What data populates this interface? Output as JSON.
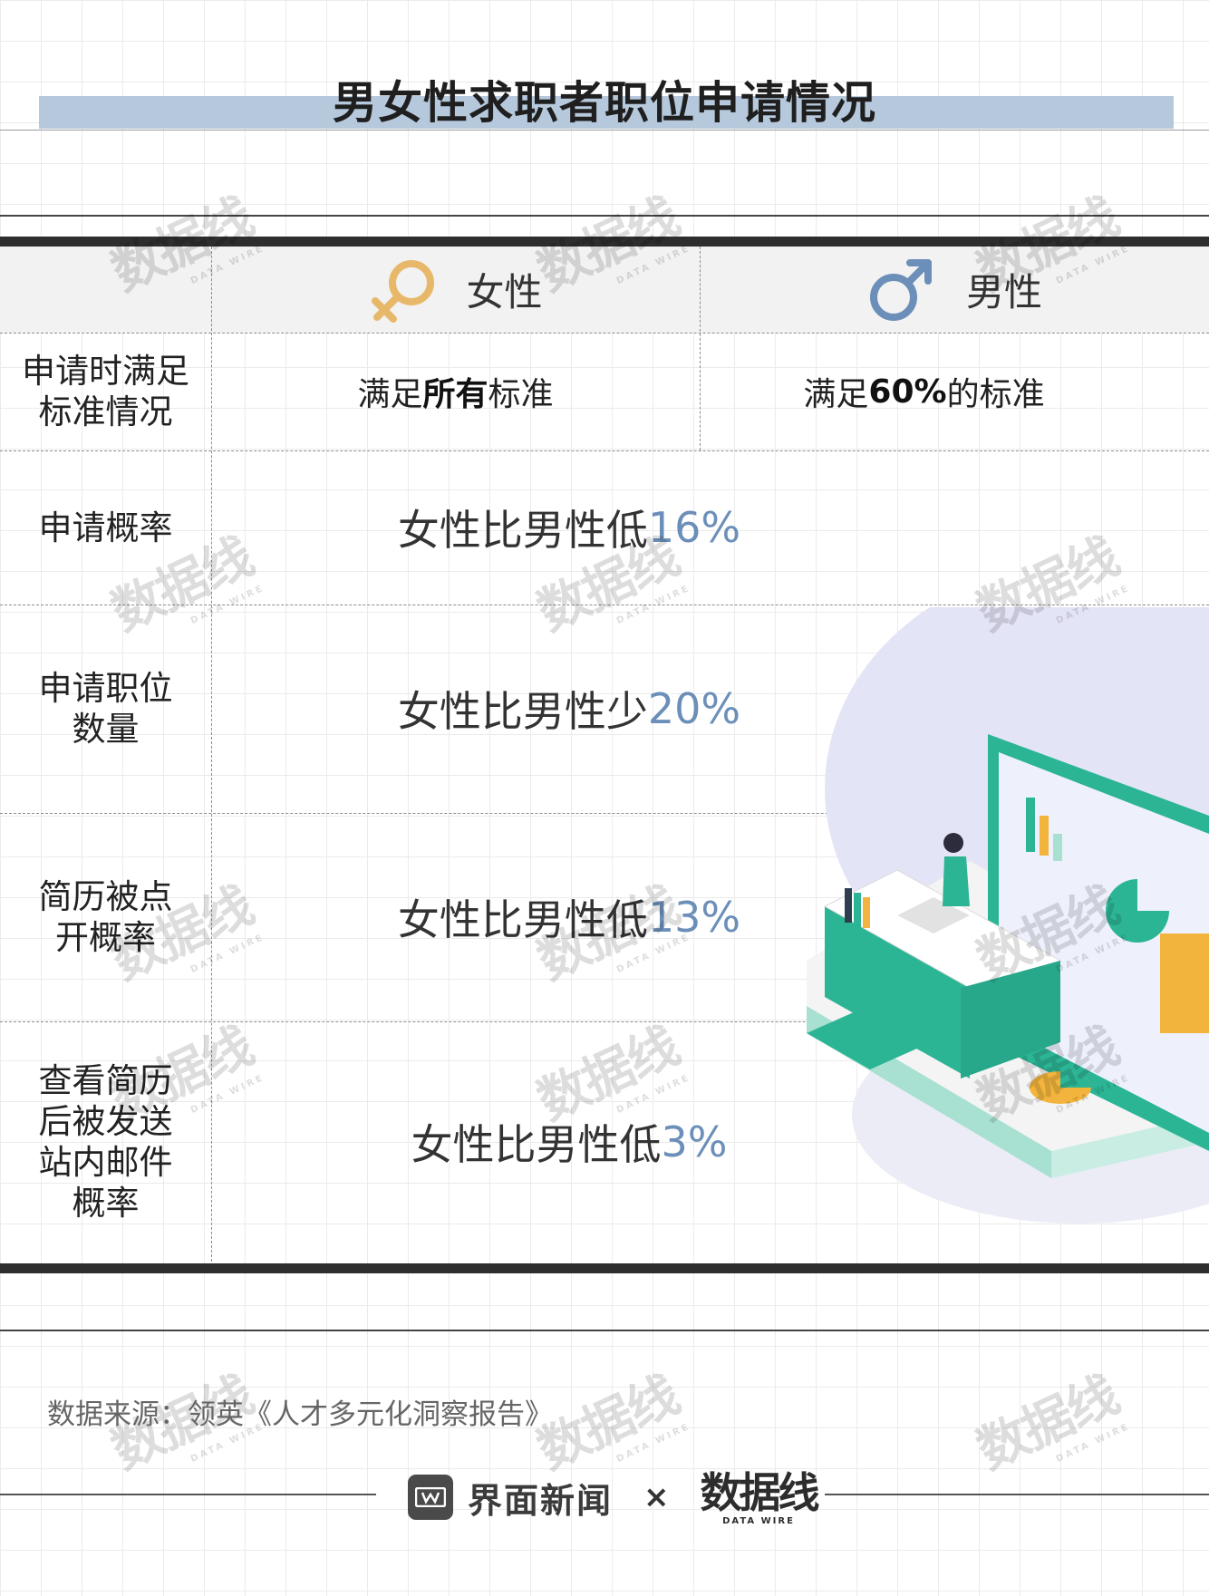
{
  "title": "男女性求职者职位申请情况",
  "header": {
    "female_label": "女性",
    "male_label": "男性",
    "female_symbol": "female-symbol-icon",
    "male_symbol": "male-symbol-icon"
  },
  "rows": [
    {
      "label_lines": [
        "申请时满足",
        "标准情况"
      ],
      "female": {
        "pre": "满足",
        "bold": "所有",
        "post": "标准"
      },
      "male": {
        "pre": "满足",
        "bold": "60%",
        "post": "的标准"
      }
    },
    {
      "label_lines": [
        "申请概率"
      ],
      "text": "女性比男性低",
      "pct": "16%"
    },
    {
      "label_lines": [
        "申请职位",
        "数量"
      ],
      "text": "女性比男性少",
      "pct": "20%"
    },
    {
      "label_lines": [
        "简历被点",
        "开概率"
      ],
      "text": "女性比男性低",
      "pct": "13%"
    },
    {
      "label_lines": [
        "查看简历",
        "后被发送",
        "站内邮件",
        "概率"
      ],
      "text": "女性比男性低",
      "pct": "3%"
    }
  ],
  "source": "数据来源：领英《人才多元化洞察报告》",
  "footer": {
    "logo1_text": "界面新闻",
    "separator": "×",
    "logo2_main": "数据线",
    "logo2_sub": "DATA WIRE"
  },
  "watermark": {
    "main": "数据线",
    "sub": "DATA WIRE"
  },
  "colors": {
    "accent_blue": "#6b8fb9",
    "title_band": "#b6c8dc",
    "female_icon": "#e8b86a",
    "male_icon": "#6b8fb9",
    "illustration_green": "#27b99a",
    "illustration_purple": "#dcdcf5"
  }
}
